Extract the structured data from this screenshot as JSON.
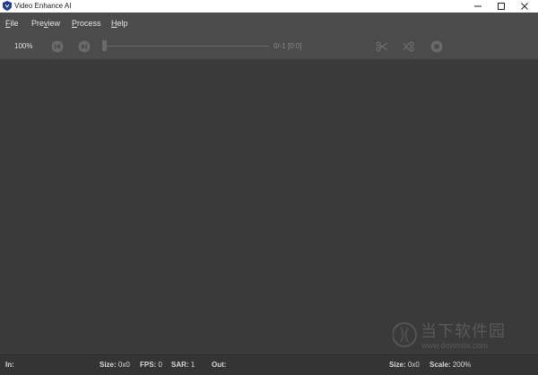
{
  "window": {
    "title": "Video Enhance AI",
    "controls": [
      "minimize-icon",
      "maximize-icon",
      "close-icon"
    ]
  },
  "menu": [
    {
      "prefix": "",
      "accel": "F",
      "rest": "ile"
    },
    {
      "prefix": "Pre",
      "accel": "v",
      "rest": "iew"
    },
    {
      "prefix": "",
      "accel": "P",
      "rest": "rocess"
    },
    {
      "prefix": "",
      "accel": "H",
      "rest": "elp"
    }
  ],
  "toolbar": {
    "zoom": "100%",
    "frame_counter": "0/-1  [0:0]",
    "icons": [
      "step-back-icon",
      "step-forward-icon",
      "cut-icon",
      "cut-segment-icon",
      "stop-icon"
    ],
    "position": 0
  },
  "status": {
    "in_label": "In:",
    "in_size_label": "Size:",
    "in_size_value": "0x0",
    "fps_label": "FPS:",
    "fps_value": "0",
    "sar_label": "SAR:",
    "sar_value": "1",
    "out_label": "Out:",
    "out_size_label": "Size:",
    "out_size_value": "0x0",
    "scale_label": "Scale:",
    "scale_value": "200%"
  },
  "watermark": {
    "text": "当下软件园",
    "url": "www.downxia.com"
  },
  "colors": {
    "background": "#3a3a3a",
    "chrome": "#4b4b4b",
    "statusbar": "#343434"
  }
}
